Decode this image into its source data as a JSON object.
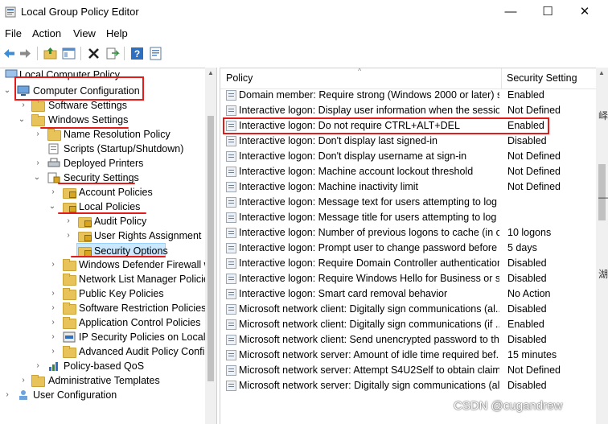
{
  "window": {
    "title": "Local Group Policy Editor",
    "minimize": "—",
    "maximize": "☐",
    "close": "✕"
  },
  "menu": [
    "File",
    "Action",
    "View",
    "Help"
  ],
  "tree": [
    {
      "label": "Local Computer Policy",
      "expanded": true
    },
    {
      "label": "Computer Configuration",
      "expanded": true
    },
    {
      "label": "Software Settings",
      "expanded": false
    },
    {
      "label": "Windows Settings",
      "expanded": true
    },
    {
      "label": "Name Resolution Policy",
      "expanded": false
    },
    {
      "label": "Scripts (Startup/Shutdown)",
      "expanded": false
    },
    {
      "label": "Deployed Printers",
      "expanded": false
    },
    {
      "label": "Security Settings",
      "expanded": true
    },
    {
      "label": "Account Policies",
      "expanded": false
    },
    {
      "label": "Local Policies",
      "expanded": true
    },
    {
      "label": "Audit Policy",
      "expanded": false
    },
    {
      "label": "User Rights Assignment",
      "expanded": false
    },
    {
      "label": "Security Options",
      "selected": true
    },
    {
      "label": "Windows Defender Firewall w",
      "expanded": false
    },
    {
      "label": "Network List Manager Policie",
      "expanded": false
    },
    {
      "label": "Public Key Policies",
      "expanded": false
    },
    {
      "label": "Software Restriction Policies",
      "expanded": false
    },
    {
      "label": "Application Control Policies",
      "expanded": false
    },
    {
      "label": "IP Security Policies on Local C",
      "expanded": false
    },
    {
      "label": "Advanced Audit Policy Confi",
      "expanded": false
    },
    {
      "label": "Policy-based QoS",
      "expanded": false
    },
    {
      "label": "Administrative Templates",
      "expanded": false
    },
    {
      "label": "User Configuration",
      "expanded": false
    }
  ],
  "list": {
    "col_policy": "Policy",
    "col_setting": "Security Setting",
    "rows": [
      {
        "policy": "Domain member: Require strong (Windows 2000 or later) se...",
        "setting": "Enabled"
      },
      {
        "policy": "Interactive logon: Display user information when the session...",
        "setting": "Not Defined"
      },
      {
        "policy": "Interactive logon: Do not require CTRL+ALT+DEL",
        "setting": "Enabled"
      },
      {
        "policy": "Interactive logon: Don't display last signed-in",
        "setting": "Disabled"
      },
      {
        "policy": "Interactive logon: Don't display username at sign-in",
        "setting": "Not Defined"
      },
      {
        "policy": "Interactive logon: Machine account lockout threshold",
        "setting": "Not Defined"
      },
      {
        "policy": "Interactive logon: Machine inactivity limit",
        "setting": "Not Defined"
      },
      {
        "policy": "Interactive logon: Message text for users attempting to log on",
        "setting": ""
      },
      {
        "policy": "Interactive logon: Message title for users attempting to log on",
        "setting": ""
      },
      {
        "policy": "Interactive logon: Number of previous logons to cache (in c...",
        "setting": "10 logons"
      },
      {
        "policy": "Interactive logon: Prompt user to change password before e...",
        "setting": "5 days"
      },
      {
        "policy": "Interactive logon: Require Domain Controller authentication...",
        "setting": "Disabled"
      },
      {
        "policy": "Interactive logon: Require Windows Hello for Business or sm...",
        "setting": "Disabled"
      },
      {
        "policy": "Interactive logon: Smart card removal behavior",
        "setting": "No Action"
      },
      {
        "policy": "Microsoft network client: Digitally sign communications (al...",
        "setting": "Disabled"
      },
      {
        "policy": "Microsoft network client: Digitally sign communications (if ...",
        "setting": "Enabled"
      },
      {
        "policy": "Microsoft network client: Send unencrypted password to thi...",
        "setting": "Disabled"
      },
      {
        "policy": "Microsoft network server: Amount of idle time required bef...",
        "setting": "15 minutes"
      },
      {
        "policy": "Microsoft network server: Attempt S4U2Self to obtain claim ...",
        "setting": "Not Defined"
      },
      {
        "policy": "Microsoft network server: Digitally sign communications (al...",
        "setting": "Disabled"
      }
    ]
  },
  "watermark": "CSDN @cugandrew",
  "side_glyphs": [
    "峄",
    "—",
    "湖"
  ],
  "colors": {
    "annotation": "#e21b1b",
    "selection": "#cce8ff"
  }
}
